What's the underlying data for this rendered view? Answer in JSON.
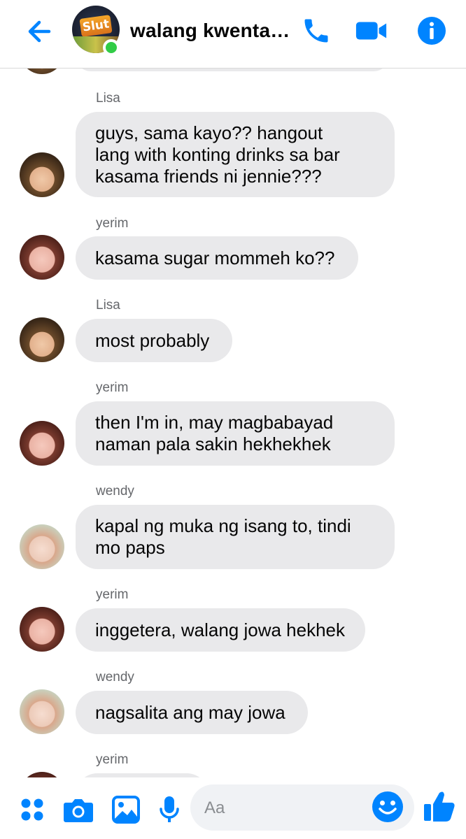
{
  "header": {
    "title": "walang kwentan...",
    "avatar_logo_text": "Slut",
    "accent_color": "#0084ff",
    "online_color": "#31cc46"
  },
  "messages": [
    {
      "sender": "Lisa",
      "avatar": "lisa",
      "text": "guys, sama kayo?? hangout\nlang with konting drinks sa bar\nkasama friends ni jennie???"
    },
    {
      "sender": "yerim",
      "avatar": "yerim",
      "text": "kasama sugar mommeh ko??"
    },
    {
      "sender": "Lisa",
      "avatar": "lisa",
      "text": "most probably"
    },
    {
      "sender": "yerim",
      "avatar": "yerim",
      "text": "then I'm in, may magbabayad\nnaman pala sakin hekhekhek"
    },
    {
      "sender": "wendy",
      "avatar": "wendy",
      "text": "kapal ng muka ng isang to, tindi\nmo paps"
    },
    {
      "sender": "yerim",
      "avatar": "yerim",
      "text": "inggetera, walang jowa hekhek"
    },
    {
      "sender": "wendy",
      "avatar": "wendy",
      "text": "nagsalita ang may jowa"
    },
    {
      "sender": "yerim",
      "avatar": "yerim",
      "text": ""
    }
  ],
  "composer": {
    "placeholder": "Aa"
  },
  "icons": {
    "back": "back-arrow-icon",
    "call": "phone-icon",
    "video": "video-camera-icon",
    "info": "info-icon",
    "menu": "four-dots-icon",
    "camera": "camera-icon",
    "gallery": "image-icon",
    "mic": "microphone-icon",
    "emoji": "emoji-icon",
    "like": "thumbs-up-icon"
  }
}
